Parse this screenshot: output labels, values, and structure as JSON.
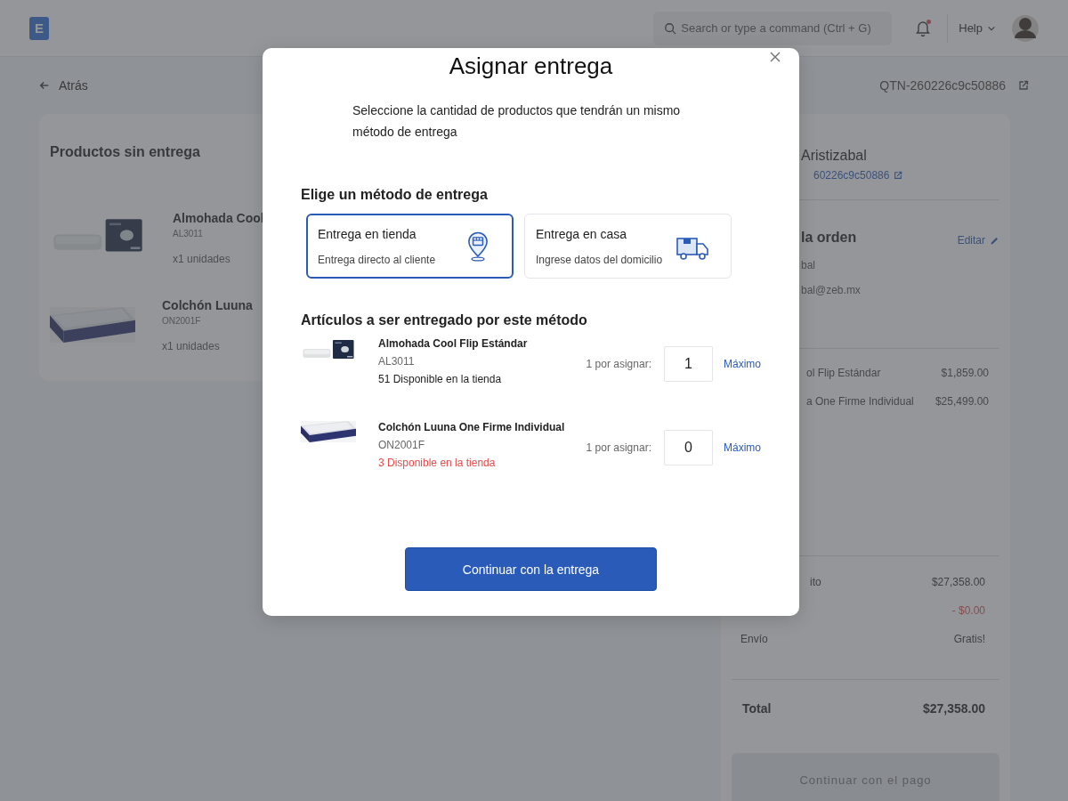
{
  "header": {
    "logo": "E",
    "search": {
      "placeholder": "Search or type a command (Ctrl + G)"
    },
    "notification": {
      "unread": true
    },
    "help": "Help"
  },
  "back": "Atrás",
  "quote_id": "QTN-260226c9c50886",
  "products_panel": {
    "title": "Productos sin entrega",
    "items": [
      {
        "name": "Almohada Cool",
        "sku": "AL3011",
        "quantity": "x1 unidades"
      },
      {
        "name": "Colchón Luuna",
        "sku": "ON2001F",
        "quantity": "x1 unidades"
      }
    ]
  },
  "summary_panel": {
    "customer": "Aristizabal",
    "quote_link": "60226c9c50886",
    "section_title": "la orden",
    "edit": "Editar",
    "contact_lines": [
      "bal",
      "bal@zeb.mx"
    ],
    "items": [
      {
        "name": "ol Flip Estándar",
        "price": "$1,859.00"
      },
      {
        "name": "a One Firme Individual",
        "price": "$25,499.00"
      }
    ],
    "totals": [
      {
        "kind": "normal",
        "label": "ito",
        "value": "$27,358.00"
      },
      {
        "kind": "discount",
        "value": "- $0.00"
      },
      {
        "kind": "normal",
        "label": "Envío",
        "value": "Gratis!"
      }
    ],
    "total": {
      "label": "Total",
      "value": "$27,358.00"
    },
    "pay_button": {
      "label": "Continuar con el pago",
      "disabled": true
    }
  },
  "modal": {
    "title": "Asignar entrega",
    "intro": "Seleccione la cantidad de productos que tendrán un mismo método de entrega",
    "methods_title": "Elige un método de entrega",
    "methods": [
      {
        "kind": "store",
        "title": "Entrega en tienda",
        "subtitle": "Entrega directo al cliente",
        "selected": true
      },
      {
        "kind": "home",
        "title": "Entrega en casa",
        "subtitle": "Ingrese datos del domicilio",
        "selected": false
      }
    ],
    "items_title": "Artículos a ser entregado por este método",
    "items": [
      {
        "name": "Almohada Cool Flip Estándar",
        "sku": "AL3011",
        "availability": "51 Disponible en la tienda",
        "low_stock": false,
        "pending": "1 por asignar:",
        "quantity": "1",
        "max": "Máximo"
      },
      {
        "name": "Colchón Luuna One Firme Individual",
        "sku": "ON2001F",
        "availability": "3 Disponible en la tienda",
        "low_stock": true,
        "pending": "1 por asignar:",
        "quantity": "0",
        "max": "Máximo"
      }
    ],
    "button": "Continuar con la entrega"
  }
}
